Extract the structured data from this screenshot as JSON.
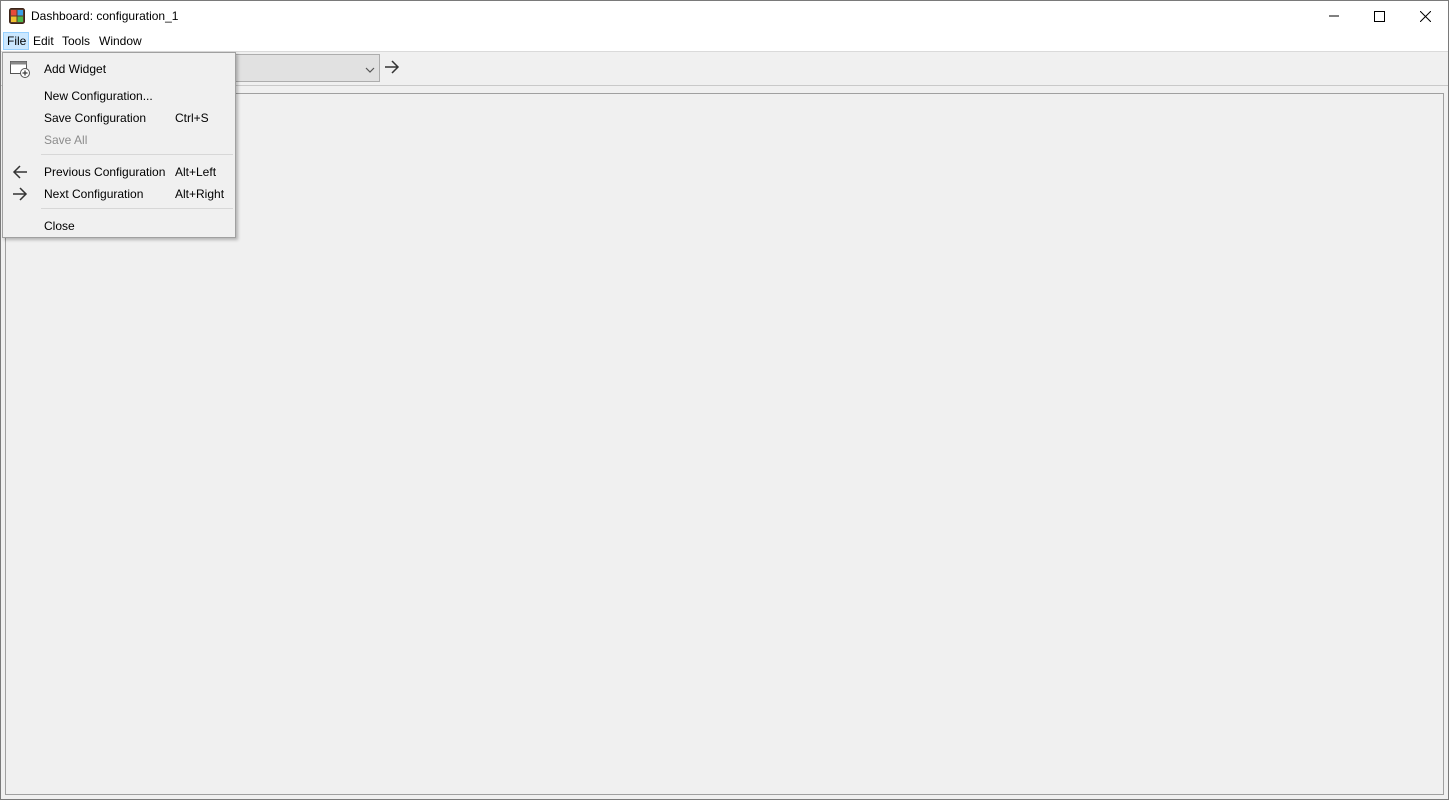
{
  "window": {
    "title": "Dashboard: configuration_1",
    "icon": "app-grid-icon"
  },
  "menubar": {
    "items": [
      {
        "label": "File",
        "active": true
      },
      {
        "label": "Edit"
      },
      {
        "label": "Tools"
      },
      {
        "label": "Window"
      }
    ]
  },
  "toolbar": {
    "combo_value": "",
    "go_icon": "arrow-right-icon"
  },
  "file_menu": {
    "items": [
      {
        "label": "Add Widget",
        "shortcut": "",
        "icon": "add-widget-icon",
        "enabled": true
      },
      {
        "label": "New Configuration...",
        "shortcut": "",
        "icon": "",
        "enabled": true
      },
      {
        "label": "Save Configuration",
        "shortcut": "Ctrl+S",
        "icon": "",
        "enabled": true
      },
      {
        "label": "Save All",
        "shortcut": "",
        "icon": "",
        "enabled": false
      },
      {
        "label": "Previous Configuration",
        "shortcut": "Alt+Left",
        "icon": "arrow-left-icon",
        "enabled": true
      },
      {
        "label": "Next Configuration",
        "shortcut": "Alt+Right",
        "icon": "arrow-right-icon",
        "enabled": true
      },
      {
        "label": "Close",
        "shortcut": "",
        "icon": "",
        "enabled": true
      }
    ]
  }
}
